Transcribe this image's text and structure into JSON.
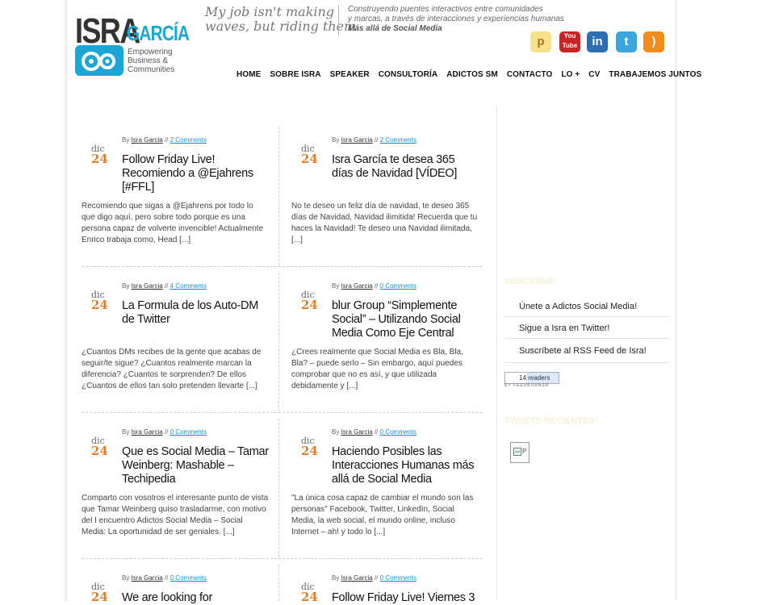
{
  "header": {
    "logo_isra": "ISRA",
    "logo_garcia": "GARCÍA",
    "logo_tagline": [
      "Empowering",
      "Business &",
      "Communities"
    ],
    "slogan": [
      "My job isn't making",
      "waves, but riding them"
    ],
    "mission": [
      "Construyendo puentes interactivos entre comunidades",
      "y marcas, a través de interacciones y experiencias humanas"
    ],
    "mission_bold": "Más allá de Social Media",
    "social_icons": [
      {
        "name": "posterous-icon",
        "glyph": "p",
        "color": "#f6e28a"
      },
      {
        "name": "youtube-icon",
        "glyph": "You Tube",
        "color": "#cc2222"
      },
      {
        "name": "linkedin-icon",
        "glyph": "in",
        "color": "#2a6fb3"
      },
      {
        "name": "twitter-icon",
        "glyph": "t",
        "color": "#3aa6dd"
      },
      {
        "name": "rss-icon",
        "glyph": ")",
        "color": "#f28b1e"
      }
    ]
  },
  "nav": [
    "HOME",
    "SOBRE ISRA",
    "SPEAKER",
    "CONSULTORÍA",
    "ADICTOS SM",
    "CONTACTO",
    "LO +",
    "CV",
    "TRABAJEMOS JUNTOS"
  ],
  "posts": [
    {
      "by": "By",
      "author": "Isra Garcia",
      "sep": "//",
      "comments": "2 Comments",
      "month": "dic",
      "day": "24",
      "title": [
        "Follow Friday Live!",
        "Recomiendo a @Ejahrens",
        "[#FFL]"
      ],
      "excerpt": [
        "Recomiendo que sigas a @Ejahrens por todo lo",
        "que digo aquí, pero sobre todo porque es una",
        "persona capaz de volverte invencible! Actualmente",
        "Enrico trabaja como, Head [...]"
      ]
    },
    {
      "by": "By",
      "author": "Isra Garcia",
      "sep": "//",
      "comments": "2 Comments",
      "month": "dic",
      "day": "24",
      "title": [
        "Isra García te desea 365",
        "días de Navidad [VÍDEO]"
      ],
      "excerpt": [
        "No te deseo un feliz día de navidad, te deseo 365",
        "días de Navidad, Navidad ilimitida! Recuerda que tu",
        "haces la Navidad! Te deseo una Navidad ilimitada,",
        "[...]"
      ]
    },
    {
      "by": "By",
      "author": "Isra Garcia",
      "sep": "//",
      "comments": "4 Comments",
      "month": "dic",
      "day": "24",
      "title": [
        "La Formula de los Auto-DM",
        "de Twitter"
      ],
      "excerpt": [
        "¿Cuantos DMs recibes de la gente que acabas de",
        "seguir/te sigue? ¿Cuantos realmente marcan la",
        "diferencia? ¿Cuantos te sorprenden? De ellos",
        "¿Cuantos de ellos tan solo pretenden llevarte [...]"
      ]
    },
    {
      "by": "By",
      "author": "Isra Garcia",
      "sep": "//",
      "comments": "0 Comments",
      "month": "dic",
      "day": "24",
      "title": [
        "blur Group “Simplemente",
        "Social” – Utilizando Social",
        "Media Como Eje Central"
      ],
      "excerpt": [
        "¿Crees realmente que Social Media es Bla, Bla,",
        "Bla? – puede serlo – Sin embargo, aquí puedes",
        "comprobar que no es así, y que utilizada",
        "debidamente y [...]"
      ]
    },
    {
      "by": "By",
      "author": "Isra Garcia",
      "sep": "//",
      "comments": "0 Comments",
      "month": "dic",
      "day": "24",
      "title": [
        "Que es Social Media – Tamar",
        "Weinberg: Mashable –",
        "Techipedia"
      ],
      "excerpt": [
        "Comparto con vosotros el interesante punto de vista",
        "que Tamar Weinberg quiso trasladarme, con motivo",
        "del I encuentro Adictos Social Media – Social",
        "Media: La oportunidad de ser geniales. [...]"
      ]
    },
    {
      "by": "By",
      "author": "Isra Garcia",
      "sep": "//",
      "comments": "0 Comments",
      "month": "dic",
      "day": "24",
      "title": [
        "Haciendo Posibles las",
        "Interacciones Humanas más",
        "allá de Social Media"
      ],
      "excerpt": [
        "\"La única cosa capaz de cambiar el mundo son las",
        "personas\" Facebook, Twitter, LinkedIn, Social",
        "Media, la web social, el mundo online, incluso",
        "Internet – ah! y todo lo [...]"
      ]
    },
    {
      "by": "By",
      "author": "Isra Garcia",
      "sep": "//",
      "comments": "0 Comments",
      "month": "dic",
      "day": "24",
      "title": [
        "We are looking for"
      ],
      "excerpt": []
    },
    {
      "by": "By",
      "author": "Isra Garcia",
      "sep": "//",
      "comments": "0 Comments",
      "month": "dic",
      "day": "24",
      "title": [
        "Follow Friday Live! Viernes 3"
      ],
      "excerpt": []
    }
  ],
  "sidebar": {
    "subscribe_title": "SUSCRIBIR!",
    "subscribe_items": [
      "Únete a Adictos Social Media!",
      "Sigue a Isra en Twitter!",
      "Suscríbete al RSS Feed de Isra!"
    ],
    "feedburner_count": "14",
    "feedburner_readers": "readers",
    "feedburner_label": "BY FEEDBURNER",
    "tweets_title": "TWEETS RECIENTES!",
    "tweet_image_alt": "P"
  }
}
